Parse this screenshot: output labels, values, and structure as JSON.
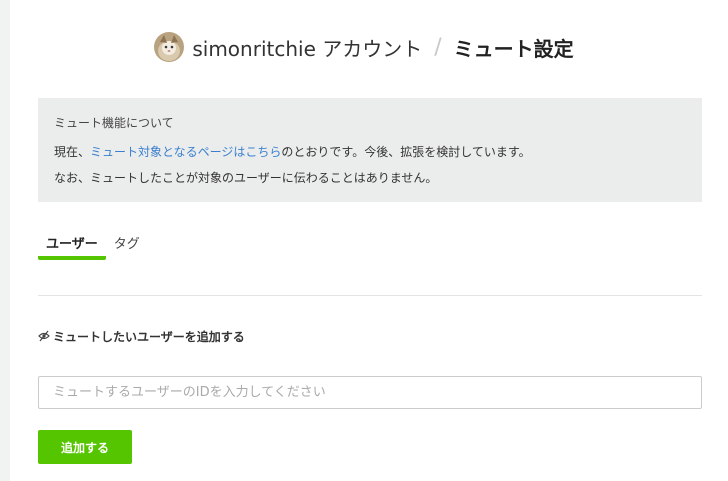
{
  "header": {
    "username": "simonritchie",
    "account_suffix": " アカウント",
    "separator": "/",
    "page_title": "ミュート設定"
  },
  "info": {
    "title": "ミュート機能について",
    "line1_prefix": "現在、",
    "line1_link": "ミュート対象となるページはこちら",
    "line1_suffix": "のとおりです。今後、拡張を検討しています。",
    "line2": "なお、ミュートしたことが対象のユーザーに伝わることはありません。"
  },
  "tabs": [
    {
      "label": "ユーザー",
      "active": true
    },
    {
      "label": "タグ",
      "active": false
    }
  ],
  "section": {
    "heading": "ミュートしたいユーザーを追加する",
    "icon": "eye-slash-icon"
  },
  "form": {
    "placeholder": "ミュートするユーザーのIDを入力してください",
    "value": "",
    "submit_label": "追加する"
  },
  "colors": {
    "accent": "#55c500",
    "link": "#3a7fd0",
    "info_bg": "#ebedec"
  }
}
